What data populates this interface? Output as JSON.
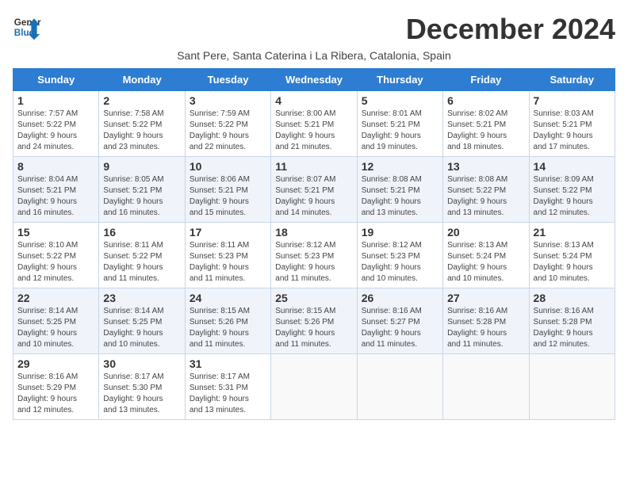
{
  "logo": {
    "line1": "General",
    "line2": "Blue"
  },
  "title": "December 2024",
  "location": "Sant Pere, Santa Caterina i La Ribera, Catalonia, Spain",
  "days_of_week": [
    "Sunday",
    "Monday",
    "Tuesday",
    "Wednesday",
    "Thursday",
    "Friday",
    "Saturday"
  ],
  "weeks": [
    [
      {
        "day": "1",
        "sunrise": "7:57 AM",
        "sunset": "5:22 PM",
        "daylight": "9 hours and 24 minutes."
      },
      {
        "day": "2",
        "sunrise": "7:58 AM",
        "sunset": "5:22 PM",
        "daylight": "9 hours and 23 minutes."
      },
      {
        "day": "3",
        "sunrise": "7:59 AM",
        "sunset": "5:22 PM",
        "daylight": "9 hours and 22 minutes."
      },
      {
        "day": "4",
        "sunrise": "8:00 AM",
        "sunset": "5:21 PM",
        "daylight": "9 hours and 21 minutes."
      },
      {
        "day": "5",
        "sunrise": "8:01 AM",
        "sunset": "5:21 PM",
        "daylight": "9 hours and 19 minutes."
      },
      {
        "day": "6",
        "sunrise": "8:02 AM",
        "sunset": "5:21 PM",
        "daylight": "9 hours and 18 minutes."
      },
      {
        "day": "7",
        "sunrise": "8:03 AM",
        "sunset": "5:21 PM",
        "daylight": "9 hours and 17 minutes."
      }
    ],
    [
      {
        "day": "8",
        "sunrise": "8:04 AM",
        "sunset": "5:21 PM",
        "daylight": "9 hours and 16 minutes."
      },
      {
        "day": "9",
        "sunrise": "8:05 AM",
        "sunset": "5:21 PM",
        "daylight": "9 hours and 16 minutes."
      },
      {
        "day": "10",
        "sunrise": "8:06 AM",
        "sunset": "5:21 PM",
        "daylight": "9 hours and 15 minutes."
      },
      {
        "day": "11",
        "sunrise": "8:07 AM",
        "sunset": "5:21 PM",
        "daylight": "9 hours and 14 minutes."
      },
      {
        "day": "12",
        "sunrise": "8:08 AM",
        "sunset": "5:21 PM",
        "daylight": "9 hours and 13 minutes."
      },
      {
        "day": "13",
        "sunrise": "8:08 AM",
        "sunset": "5:22 PM",
        "daylight": "9 hours and 13 minutes."
      },
      {
        "day": "14",
        "sunrise": "8:09 AM",
        "sunset": "5:22 PM",
        "daylight": "9 hours and 12 minutes."
      }
    ],
    [
      {
        "day": "15",
        "sunrise": "8:10 AM",
        "sunset": "5:22 PM",
        "daylight": "9 hours and 12 minutes."
      },
      {
        "day": "16",
        "sunrise": "8:11 AM",
        "sunset": "5:22 PM",
        "daylight": "9 hours and 11 minutes."
      },
      {
        "day": "17",
        "sunrise": "8:11 AM",
        "sunset": "5:23 PM",
        "daylight": "9 hours and 11 minutes."
      },
      {
        "day": "18",
        "sunrise": "8:12 AM",
        "sunset": "5:23 PM",
        "daylight": "9 hours and 11 minutes."
      },
      {
        "day": "19",
        "sunrise": "8:12 AM",
        "sunset": "5:23 PM",
        "daylight": "9 hours and 10 minutes."
      },
      {
        "day": "20",
        "sunrise": "8:13 AM",
        "sunset": "5:24 PM",
        "daylight": "9 hours and 10 minutes."
      },
      {
        "day": "21",
        "sunrise": "8:13 AM",
        "sunset": "5:24 PM",
        "daylight": "9 hours and 10 minutes."
      }
    ],
    [
      {
        "day": "22",
        "sunrise": "8:14 AM",
        "sunset": "5:25 PM",
        "daylight": "9 hours and 10 minutes."
      },
      {
        "day": "23",
        "sunrise": "8:14 AM",
        "sunset": "5:25 PM",
        "daylight": "9 hours and 10 minutes."
      },
      {
        "day": "24",
        "sunrise": "8:15 AM",
        "sunset": "5:26 PM",
        "daylight": "9 hours and 11 minutes."
      },
      {
        "day": "25",
        "sunrise": "8:15 AM",
        "sunset": "5:26 PM",
        "daylight": "9 hours and 11 minutes."
      },
      {
        "day": "26",
        "sunrise": "8:16 AM",
        "sunset": "5:27 PM",
        "daylight": "9 hours and 11 minutes."
      },
      {
        "day": "27",
        "sunrise": "8:16 AM",
        "sunset": "5:28 PM",
        "daylight": "9 hours and 11 minutes."
      },
      {
        "day": "28",
        "sunrise": "8:16 AM",
        "sunset": "5:28 PM",
        "daylight": "9 hours and 12 minutes."
      }
    ],
    [
      {
        "day": "29",
        "sunrise": "8:16 AM",
        "sunset": "5:29 PM",
        "daylight": "9 hours and 12 minutes."
      },
      {
        "day": "30",
        "sunrise": "8:17 AM",
        "sunset": "5:30 PM",
        "daylight": "9 hours and 13 minutes."
      },
      {
        "day": "31",
        "sunrise": "8:17 AM",
        "sunset": "5:31 PM",
        "daylight": "9 hours and 13 minutes."
      },
      null,
      null,
      null,
      null
    ]
  ],
  "labels": {
    "sunrise": "Sunrise:",
    "sunset": "Sunset:",
    "daylight": "Daylight:"
  },
  "accent_color": "#2d7dd2"
}
